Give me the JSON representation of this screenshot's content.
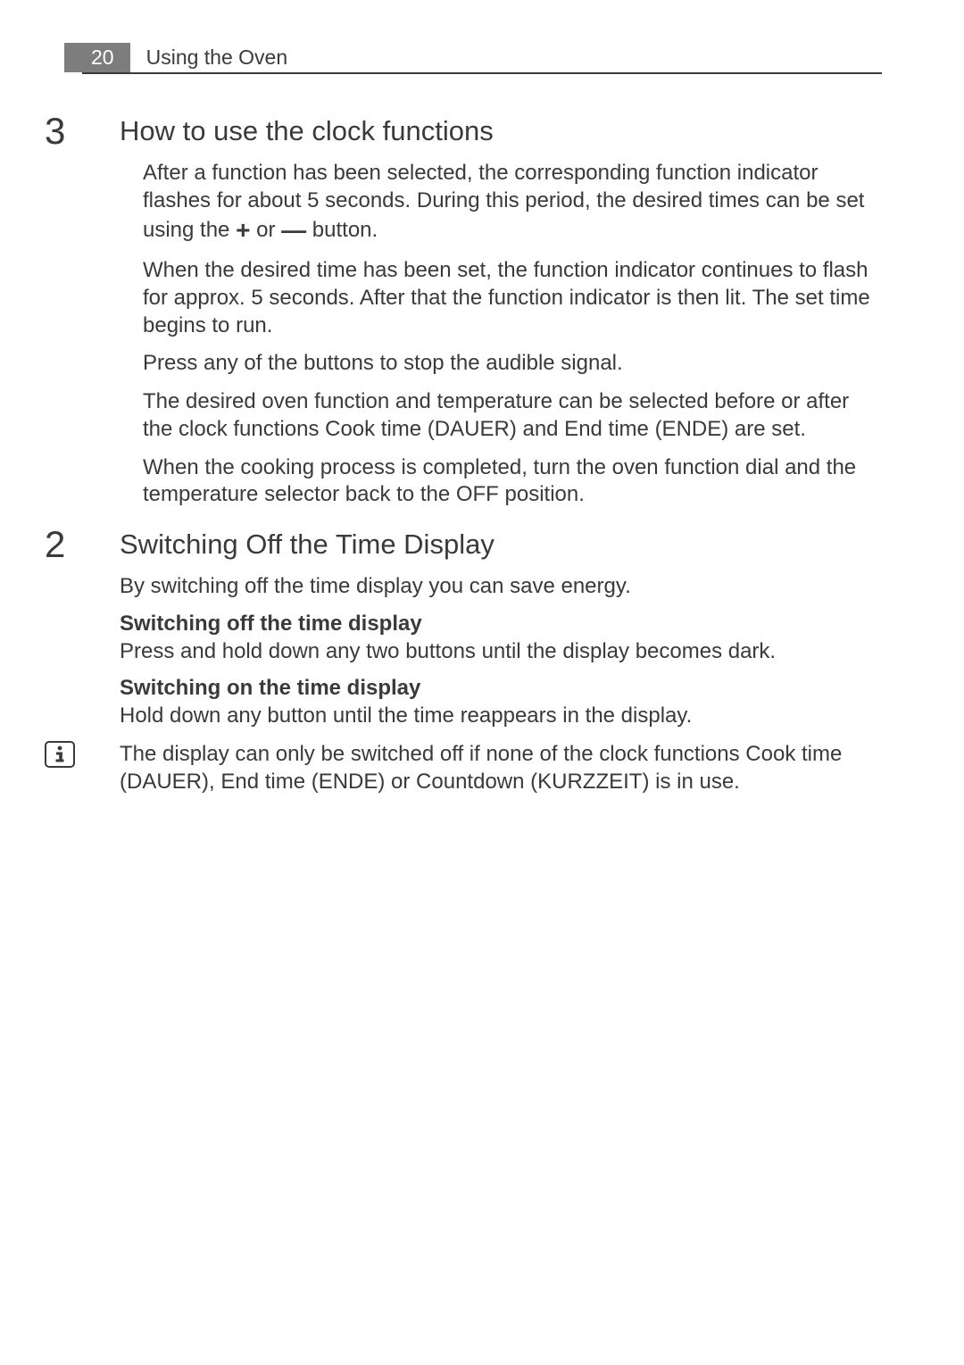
{
  "header": {
    "page_number": "20",
    "running_title": "Using the Oven"
  },
  "sections": [
    {
      "marker": "3",
      "heading": "How to use the clock functions",
      "paragraphs": [
        {
          "text_pre": "After a function has been selected, the corresponding function indicator flashes for about 5 seconds. During this period, the desired times can be set using the ",
          "plus": "+",
          "mid": " or ",
          "minus": "—",
          "text_post": " button."
        },
        {
          "text": "When the desired time has been set, the function indicator continues to flash for approx. 5 seconds. After that the function indicator is then lit. The set time begins to run."
        },
        {
          "text": "Press any of the buttons to stop the audible signal."
        },
        {
          "text": "The desired oven function and temperature can be selected before or after the clock functions Cook time (DAUER) and End time (ENDE) are set."
        },
        {
          "text": "When the cooking process is completed, turn the oven function dial and the temperature selector back to the OFF position."
        }
      ]
    },
    {
      "marker": "2",
      "heading": "Switching Off the Time Display",
      "intro": "By switching off the time display you can save energy.",
      "sub1_heading": "Switching off the time display",
      "sub1_text": "Press and hold down any two buttons until the display becomes dark.",
      "sub2_heading": "Switching on the time display",
      "sub2_text": "Hold down any button until the time reappears in the display.",
      "info_text": "The display can only be switched off if none of the clock functions Cook time (DAUER), End time (ENDE) or Countdown (KURZZEIT) is in use."
    }
  ]
}
